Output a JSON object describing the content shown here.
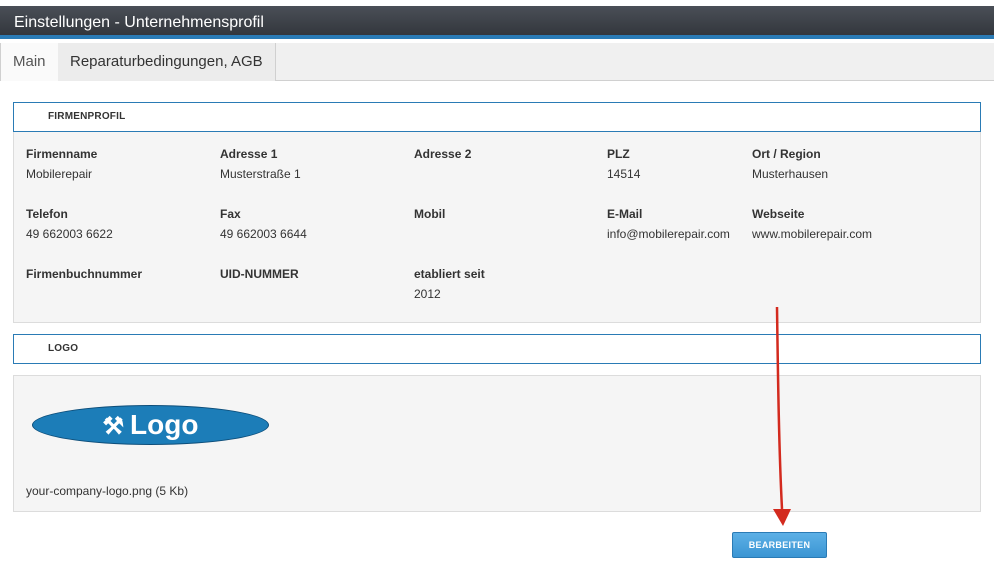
{
  "window": {
    "title": "Einstellungen - Unternehmensprofil"
  },
  "tabs": [
    {
      "label": "Main",
      "active": true
    },
    {
      "label": "Reparaturbedingungen, AGB",
      "active": false
    }
  ],
  "profile": {
    "header": "FIRMENPROFIL",
    "fields": {
      "firmenname": {
        "label": "Firmenname",
        "value": "Mobilerepair"
      },
      "adresse1": {
        "label": "Adresse 1",
        "value": "Musterstraße 1"
      },
      "adresse2": {
        "label": "Adresse 2",
        "value": ""
      },
      "plz": {
        "label": "PLZ",
        "value": "14514"
      },
      "ort": {
        "label": "Ort / Region",
        "value": "Musterhausen"
      },
      "telefon": {
        "label": "Telefon",
        "value": "49 662003 6622"
      },
      "fax": {
        "label": "Fax",
        "value": "49 662003 6644"
      },
      "mobil": {
        "label": "Mobil",
        "value": ""
      },
      "email": {
        "label": "E-Mail",
        "value": "info@mobilerepair.com"
      },
      "webseite": {
        "label": "Webseite",
        "value": "www.mobilerepair.com"
      },
      "firmenbuch": {
        "label": "Firmenbuchnummer",
        "value": ""
      },
      "uid": {
        "label": "UID-NUMMER",
        "value": ""
      },
      "etabliert": {
        "label": "etabliert seit",
        "value": "2012"
      }
    }
  },
  "logo": {
    "header": "LOGO",
    "image_text": "Logo",
    "icon": "wrench-screwdriver-icon",
    "file_info": "your-company-logo.png (5 Kb)"
  },
  "actions": {
    "edit_label": "BEARBEITEN"
  },
  "colors": {
    "accent": "#2a7bb5",
    "button": "#4aa3dd",
    "annotation_arrow": "#d32a1e"
  }
}
